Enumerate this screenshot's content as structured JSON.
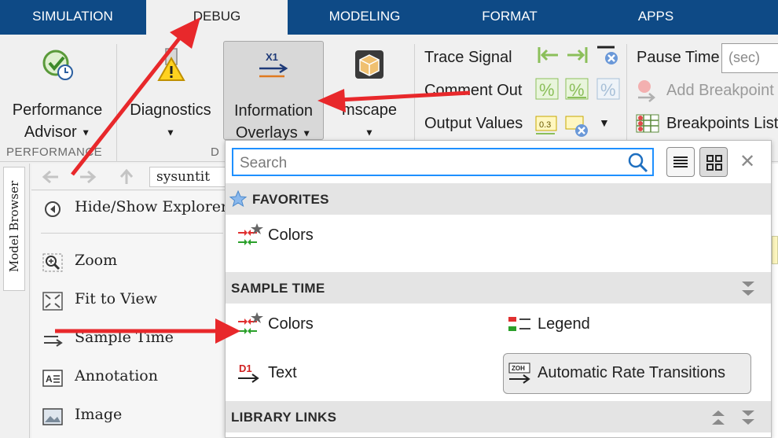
{
  "tabs": [
    {
      "label": "SIMULATION"
    },
    {
      "label": "DEBUG"
    },
    {
      "label": "MODELING"
    },
    {
      "label": "FORMAT"
    },
    {
      "label": "APPS"
    }
  ],
  "ribbon": {
    "performance_advisor": {
      "line1": "Performance",
      "line2": "Advisor"
    },
    "diagnostics": {
      "label": "Diagnostics"
    },
    "information_overlays": {
      "line1": "Information",
      "line2": "Overlays"
    },
    "simscape": {
      "label": "mscape"
    },
    "trace_signal": "Trace Signal",
    "comment_out": "Comment Out",
    "output_values": "Output Values",
    "pause_time": "Pause Time",
    "pause_placeholder": "(sec)",
    "add_breakpoint": "Add Breakpoint",
    "breakpoints_list": "Breakpoints List",
    "group_performance": "PERFORMANCE",
    "group_d": "D"
  },
  "model_browser": {
    "vertical_tab": "Model Browser",
    "breadcrumb": "sysuntit",
    "items": [
      {
        "label": "Hide/Show Explorer"
      },
      {
        "label": "Zoom"
      },
      {
        "label": "Fit to View"
      },
      {
        "label": "Sample Time"
      },
      {
        "label": "Annotation"
      },
      {
        "label": "Image"
      }
    ]
  },
  "dropdown": {
    "search_placeholder": "Search",
    "sections": {
      "favorites": "FAVORITES",
      "sample_time": "SAMPLE TIME",
      "library_links": "LIBRARY LINKS"
    },
    "favorites_items": [
      {
        "label": "Colors"
      }
    ],
    "sample_time_items": [
      {
        "label": "Colors"
      },
      {
        "label": "Legend"
      },
      {
        "label": "Text"
      },
      {
        "label": "Automatic Rate Transitions"
      }
    ]
  },
  "colors": {
    "tab_bar": "#0e4a86",
    "search_border": "#1e90ff",
    "annotation_arrow": "#e8282b"
  }
}
